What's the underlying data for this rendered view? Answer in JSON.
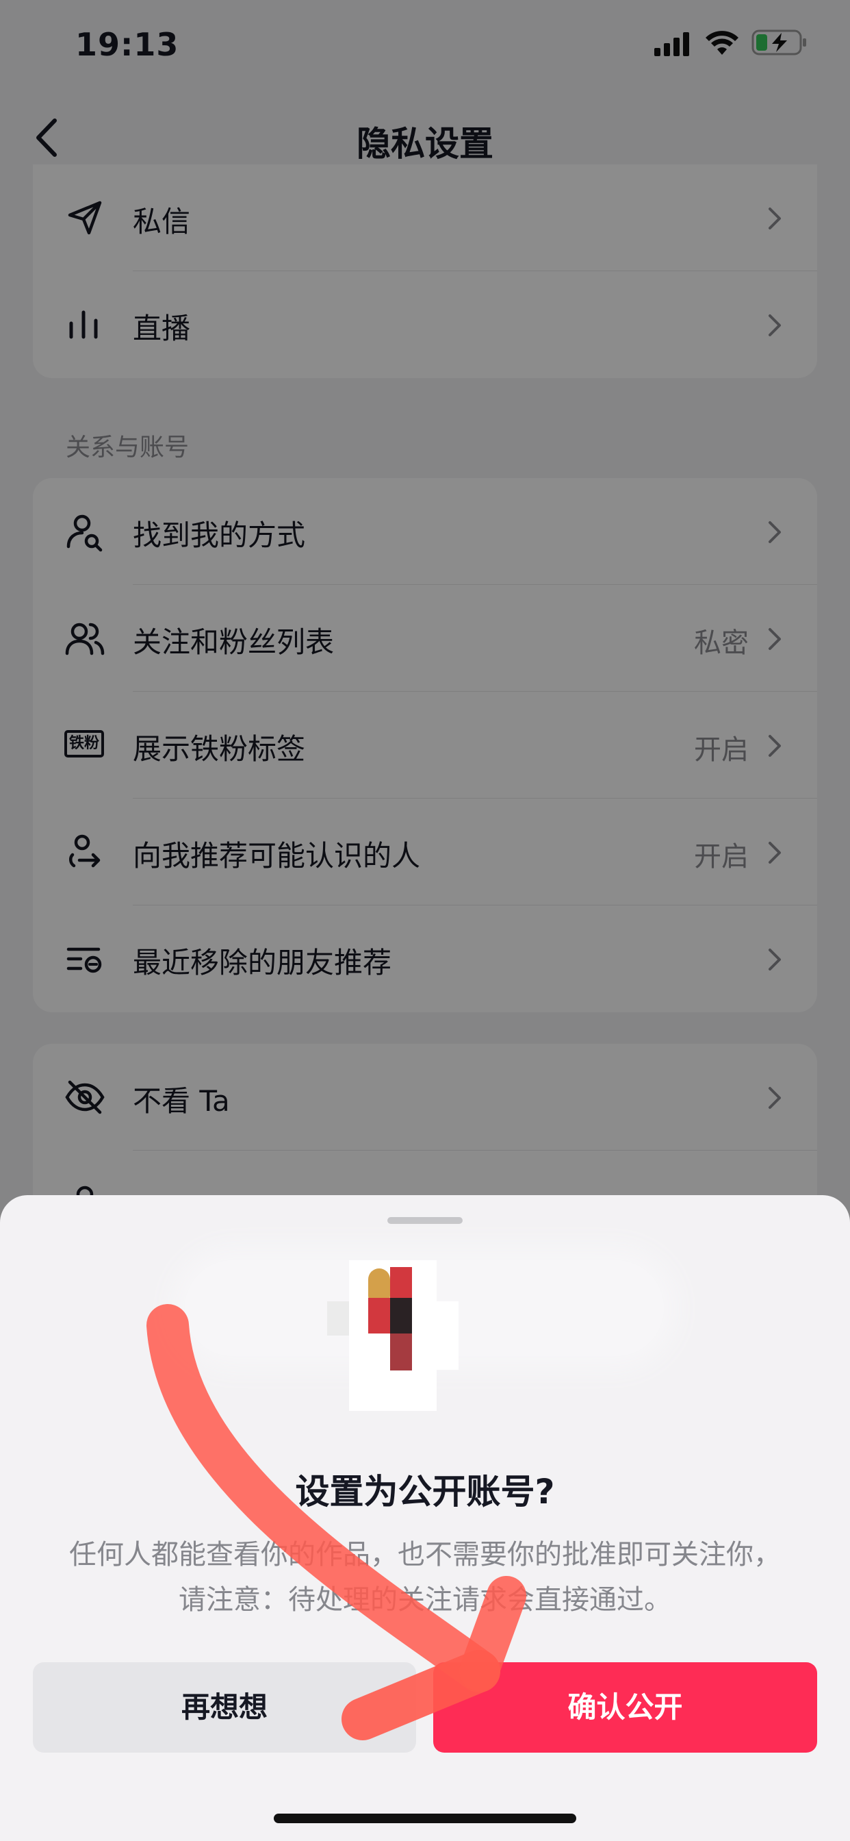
{
  "status": {
    "time": "19:13"
  },
  "nav": {
    "title": "隐私设置"
  },
  "card1": [
    {
      "icon": "paper-plane-icon",
      "label": "私信",
      "value": ""
    },
    {
      "icon": "live-bars-icon",
      "label": "直播",
      "value": ""
    }
  ],
  "section_title": "关系与账号",
  "card2": [
    {
      "icon": "person-search-icon",
      "label": "找到我的方式",
      "value": ""
    },
    {
      "icon": "people-icon",
      "label": "关注和粉丝列表",
      "value": "私密"
    },
    {
      "icon": "iron-fan-badge-icon",
      "label": "展示铁粉标签",
      "value": "开启",
      "badge_text": "铁粉"
    },
    {
      "icon": "person-recommend-icon",
      "label": "向我推荐可能认识的人",
      "value": "开启"
    },
    {
      "icon": "removed-list-icon",
      "label": "最近移除的朋友推荐",
      "value": ""
    }
  ],
  "card3": [
    {
      "icon": "eye-off-icon",
      "label": "不看 Ta",
      "value": ""
    }
  ],
  "sheet": {
    "title": "设置为公开账号?",
    "description": "任何人都能查看你的作品，也不需要你的批准即可关注你，请注意：待处理的关注请求会直接通过。",
    "cancel_label": "再想想",
    "confirm_label": "确认公开"
  },
  "colors": {
    "accent": "#fe2c55",
    "arrow": "#ff5a4e"
  }
}
